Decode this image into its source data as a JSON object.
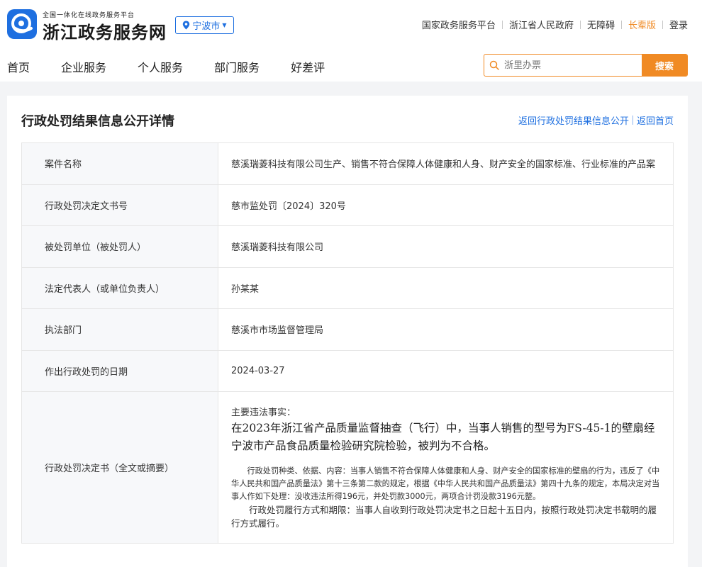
{
  "brand": {
    "tagline": "全国一体化在线政务服务平台",
    "name": "浙江政务服务网",
    "city": "宁波市",
    "colors": {
      "primary": "#1e6fe0",
      "accent": "#f08a24"
    }
  },
  "top_links": {
    "national": "国家政务服务平台",
    "province": "浙江省人民政府",
    "accessibility": "无障碍",
    "elder": "长辈版",
    "login": "登录"
  },
  "nav": {
    "home": "首页",
    "enterprise": "企业服务",
    "personal": "个人服务",
    "department": "部门服务",
    "review": "好差评"
  },
  "search": {
    "placeholder": "浙里办票",
    "button": "搜索"
  },
  "page": {
    "title": "行政处罚结果信息公开详情",
    "back_list": "返回行政处罚结果信息公开",
    "back_home": "返回首页"
  },
  "detail": {
    "rows": [
      {
        "label": "案件名称",
        "value": "慈溪瑞菱科技有限公司生产、销售不符合保障人体健康和人身、财产安全的国家标准、行业标准的产品案"
      },
      {
        "label": "行政处罚决定文书号",
        "value": "慈市监处罚〔2024〕320号"
      },
      {
        "label": "被处罚单位（被处罚人）",
        "value": "慈溪瑞菱科技有限公司"
      },
      {
        "label": "法定代表人（或单位负责人）",
        "value": "孙某某"
      },
      {
        "label": "执法部门",
        "value": "慈溪市市场监督管理局"
      },
      {
        "label": "作出行政处罚的日期",
        "value": "2024-03-27"
      }
    ],
    "decision": {
      "label": "行政处罚决定书（全文或摘要）",
      "fact_head": "主要违法事实：",
      "fact_body": "在2023年浙江省产品质量监督抽查（飞行）中，当事人销售的型号为FS-45-1的壁扇经宁波市产品食品质量检验研究院检验，被判为不合格。",
      "basis": "行政处罚种类、依据、内容：当事人销售不符合保障人体健康和人身、财产安全的国家标准的壁扇的行为，违反了《中华人民共和国产品质量法》第十三条第二款的规定，根据《中华人民共和国产品质量法》第四十九条的规定，本局决定对当事人作如下处理：没收违法所得196元，并处罚款3000元，两项合计罚没款3196元整。",
      "execution": "行政处罚履行方式和期限：当事人自收到行政处罚决定书之日起十五日内，按照行政处罚决定书载明的履行方式履行。"
    }
  }
}
